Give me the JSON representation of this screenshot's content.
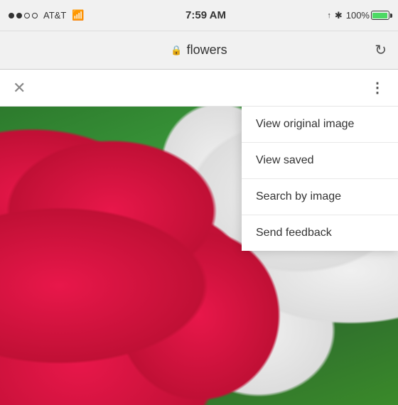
{
  "status_bar": {
    "carrier": "AT&T",
    "time": "7:59 AM",
    "battery_pct": "100%"
  },
  "address_bar": {
    "site_title": "flowers",
    "refresh_label": "↻"
  },
  "toolbar": {
    "close_label": "✕",
    "more_label": "⋮"
  },
  "context_menu": {
    "items": [
      {
        "id": "view-original",
        "label": "View original image"
      },
      {
        "id": "view-saved",
        "label": "View saved"
      },
      {
        "id": "search-by-image",
        "label": "Search by image"
      },
      {
        "id": "send-feedback",
        "label": "Send feedback"
      }
    ]
  }
}
